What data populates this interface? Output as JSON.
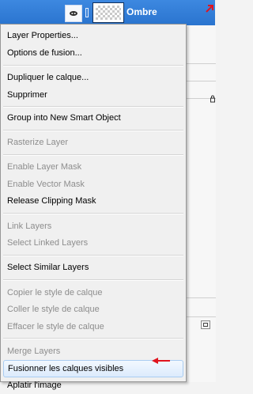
{
  "layers_panel": {
    "layer_name": "Ombre"
  },
  "menu": {
    "items": [
      {
        "label": "Layer Properties...",
        "enabled": true
      },
      {
        "label": "Options de fusion...",
        "enabled": true
      },
      {
        "label": "Dupliquer le calque...",
        "enabled": true
      },
      {
        "label": "Supprimer",
        "enabled": true
      },
      {
        "label": "Group into New Smart Object",
        "enabled": true
      },
      {
        "label": "Rasterize Layer",
        "enabled": false
      },
      {
        "label": "Enable Layer Mask",
        "enabled": false
      },
      {
        "label": "Enable Vector Mask",
        "enabled": false
      },
      {
        "label": "Release Clipping Mask",
        "enabled": true
      },
      {
        "label": "Link Layers",
        "enabled": false
      },
      {
        "label": "Select Linked Layers",
        "enabled": false
      },
      {
        "label": "Select Similar Layers",
        "enabled": true
      },
      {
        "label": "Copier le style de calque",
        "enabled": false
      },
      {
        "label": "Coller le style de calque",
        "enabled": false
      },
      {
        "label": "Effacer le style de calque",
        "enabled": false
      },
      {
        "label": "Merge Layers",
        "enabled": false
      },
      {
        "label": "Fusionner les calques visibles",
        "enabled": true,
        "highlighted": true
      },
      {
        "label": "Aplatir l'image",
        "enabled": true
      }
    ]
  },
  "colors": {
    "selected_layer": "#2a74cf",
    "annotation_arrow": "#e0141e",
    "highlight_border": "#a9ccf1"
  }
}
